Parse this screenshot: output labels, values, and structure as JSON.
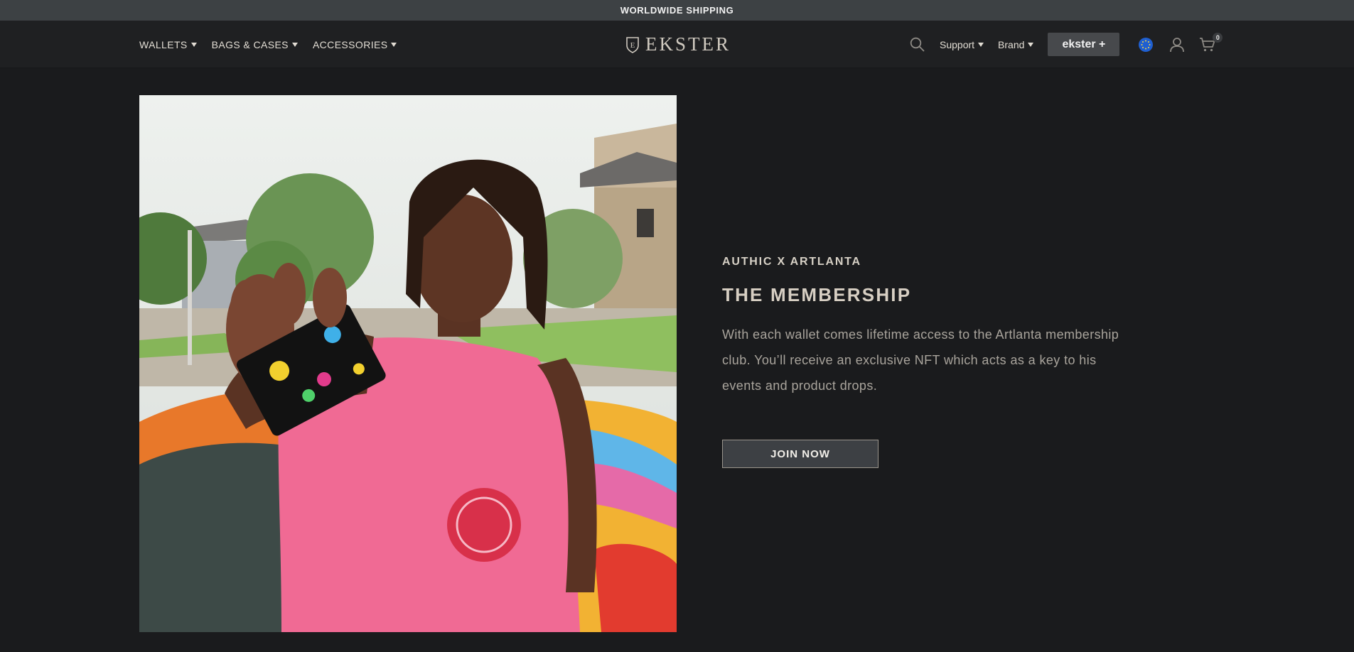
{
  "announcement": "WORLDWIDE SHIPPING",
  "nav": {
    "left": [
      {
        "label": "WALLETS"
      },
      {
        "label": "BAGS & CASES"
      },
      {
        "label": "ACCESSORIES"
      }
    ],
    "logo": "EKSTER",
    "support_label": "Support",
    "brand_label": "Brand",
    "plus_label": "ekster +",
    "cart_count": "0"
  },
  "hero": {
    "eyebrow": "AUTHIC X ARTLANTA",
    "title": "THE MEMBERSHIP",
    "description": "With each wallet comes lifetime access to the Artlanta membership club. You’ll receive an exclusive NFT which acts as a key to his events and product drops.",
    "cta_label": "JOIN NOW"
  },
  "colors": {
    "background": "#1a1b1d",
    "announce_bar": "#3d4144",
    "nav_bar": "#1f2022",
    "text_light": "#d7d1c6",
    "shirt_pink": "#f06a94",
    "region_blue": "#1f5fd1"
  },
  "icons": [
    "shield-logo-icon",
    "search-icon",
    "globe-region-icon",
    "user-icon",
    "cart-icon",
    "caret-down-icon"
  ]
}
